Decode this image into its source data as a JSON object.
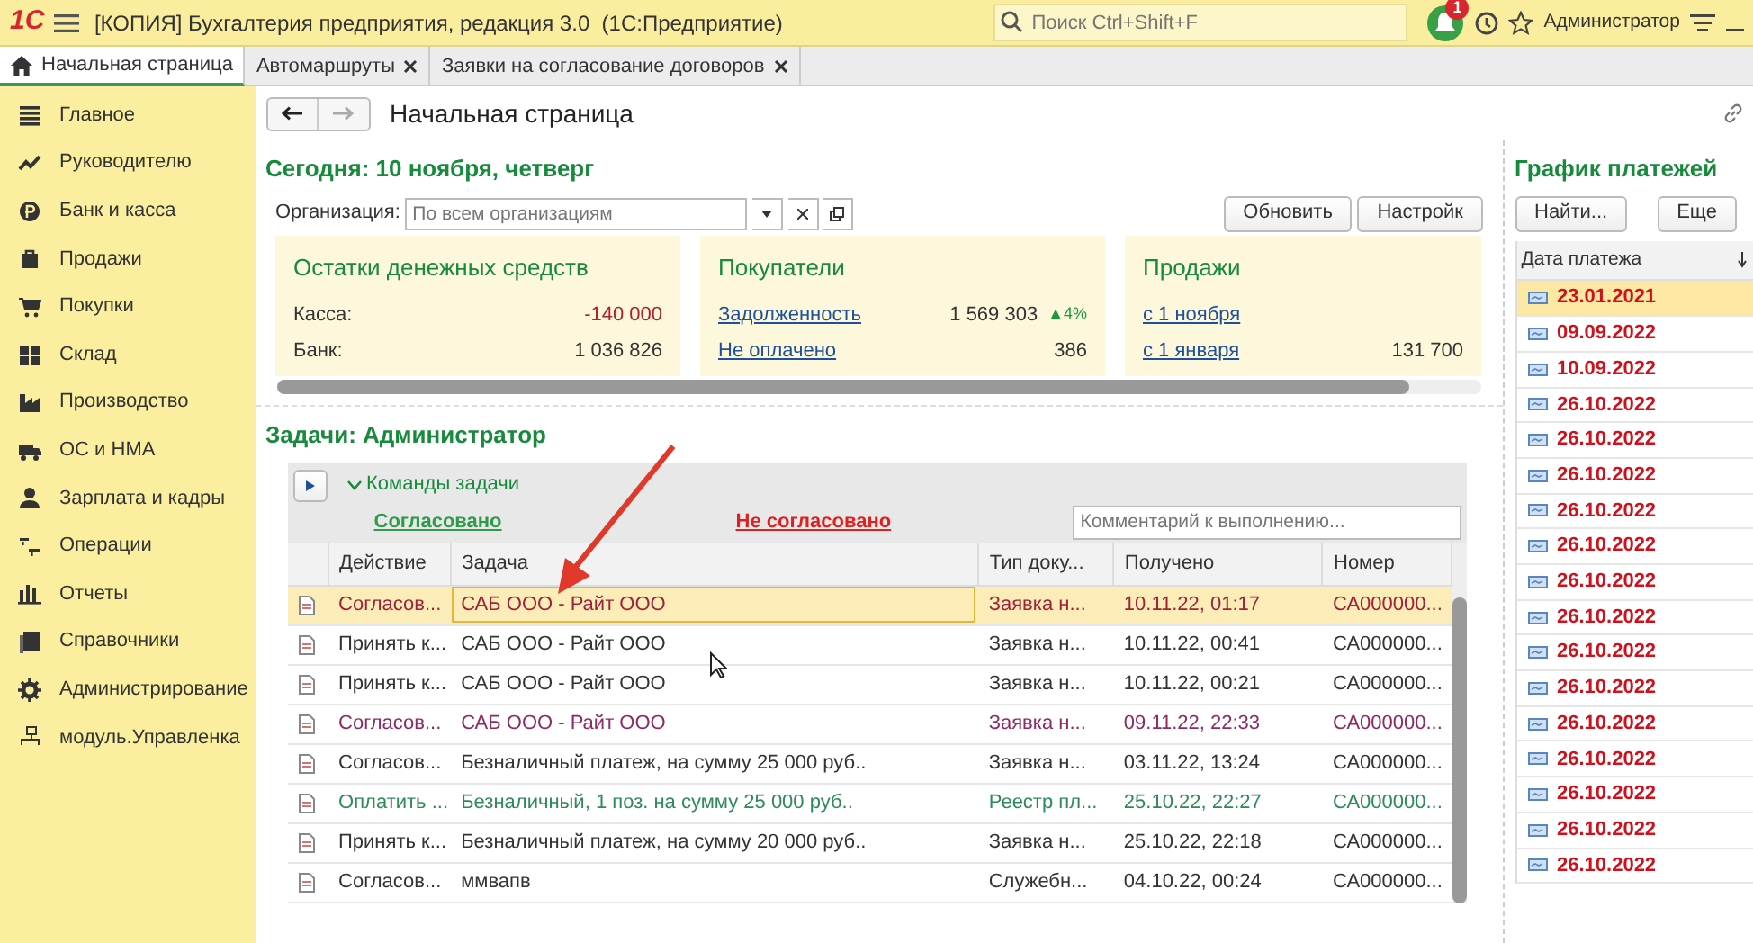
{
  "window": {
    "logo": "1С",
    "title": "[КОПИЯ] Бухгалтерия предприятия, редакция 3.0  (1С:Предприятие)",
    "search_placeholder": "Поиск Ctrl+Shift+F",
    "notifications": "1",
    "user": "Администратор"
  },
  "tabs": [
    {
      "label": "Начальная страница",
      "selected": true,
      "closable": false
    },
    {
      "label": "Автомаршруты",
      "selected": false,
      "closable": true
    },
    {
      "label": "Заявки на согласование договоров",
      "selected": false,
      "closable": true
    }
  ],
  "sidebar": {
    "items": [
      {
        "label": "Главное"
      },
      {
        "label": "Руководителю"
      },
      {
        "label": "Банк и касса"
      },
      {
        "label": "Продажи"
      },
      {
        "label": "Покупки"
      },
      {
        "label": "Склад"
      },
      {
        "label": "Производство"
      },
      {
        "label": "ОС и НМА"
      },
      {
        "label": "Зарплата и кадры"
      },
      {
        "label": "Операции"
      },
      {
        "label": "Отчеты"
      },
      {
        "label": "Справочники"
      },
      {
        "label": "Администрирование"
      },
      {
        "label": "модуль.Управленка"
      }
    ]
  },
  "page": {
    "title": "Начальная страница",
    "today": "Сегодня: 10 ноября, четверг",
    "org_label": "Организация:",
    "org_placeholder": "По всем организациям",
    "buttons": [
      "Обновить",
      "Настройк"
    ],
    "widgets": [
      {
        "title": "Остатки денежных средств",
        "rows": [
          {
            "label": "Касса:",
            "link": false,
            "value": "-140 000",
            "negative": true
          },
          {
            "label": "Банк:",
            "link": false,
            "value": "1 036 826",
            "negative": false
          }
        ]
      },
      {
        "title": "Покупатели",
        "rows": [
          {
            "label": "Задолженность",
            "link": true,
            "value": "1 569 303",
            "negative": false,
            "change": "▲4%"
          },
          {
            "label": "Не оплачено",
            "link": true,
            "value": "386",
            "negative": false
          }
        ]
      },
      {
        "title": "Продажи",
        "rows": [
          {
            "label": "с 1 ноября",
            "link": true
          },
          {
            "label": "с 1 января",
            "link": true,
            "value": "131 700",
            "negative": false
          }
        ]
      }
    ]
  },
  "tasks": {
    "title": "Задачи: Администратор",
    "commands_label": "Команды задачи",
    "expanded": true,
    "approve": "Согласовано",
    "reject": "Не согласовано",
    "comment_placeholder": "Комментарий к выполнению...",
    "columns": [
      "Действие",
      "Задача",
      "Тип доку...",
      "Получено",
      "Номер"
    ],
    "rows": [
      {
        "selected": true,
        "color": "#a0213a",
        "cells": [
          "Согласов...",
          "САБ ООО - Райт ООО",
          "Заявка н...",
          "10.11.22, 01:17",
          "СА000000..."
        ]
      },
      {
        "selected": false,
        "color": "#333333",
        "cells": [
          "Принять к...",
          "САБ ООО - Райт ООО",
          "Заявка н...",
          "10.11.22, 00:41",
          "СА000000..."
        ]
      },
      {
        "selected": false,
        "color": "#333333",
        "cells": [
          "Принять к...",
          "САБ ООО - Райт ООО",
          "Заявка н...",
          "10.11.22, 00:21",
          "СА000000..."
        ]
      },
      {
        "selected": false,
        "color": "#8e2a63",
        "cells": [
          "Согласов...",
          "САБ ООО - Райт ООО",
          "Заявка н...",
          "09.11.22, 22:33",
          "СА000000..."
        ]
      },
      {
        "selected": false,
        "color": "#333333",
        "cells": [
          "Согласов...",
          "Безналичный платеж,  на сумму 25 000 руб..",
          "Заявка н...",
          "03.11.22, 13:24",
          "СА000000..."
        ]
      },
      {
        "selected": false,
        "color": "#2e8b57",
        "cells": [
          "Оплатить ...",
          "Безналичный, 1 поз. на сумму 25 000 руб..",
          "Реестр пл...",
          "25.10.22, 22:27",
          "СА000000..."
        ]
      },
      {
        "selected": false,
        "color": "#333333",
        "cells": [
          "Принять к...",
          "Безналичный платеж,  на сумму 20 000 руб..",
          "Заявка н...",
          "25.10.22, 22:18",
          "СА000000..."
        ]
      },
      {
        "selected": false,
        "color": "#333333",
        "cells": [
          "Согласов...",
          "ммвапв",
          "Служебн...",
          "04.10.22, 00:24",
          "СА000000..."
        ]
      }
    ]
  },
  "payments": {
    "title": "График платежей",
    "buttons": [
      "Найти...",
      "Еще"
    ],
    "column": "Дата платежа",
    "rows": [
      {
        "date": "23.01.2021",
        "selected": true
      },
      {
        "date": "09.09.2022",
        "selected": false
      },
      {
        "date": "10.09.2022",
        "selected": false
      },
      {
        "date": "26.10.2022",
        "selected": false
      },
      {
        "date": "26.10.2022",
        "selected": false
      },
      {
        "date": "26.10.2022",
        "selected": false
      },
      {
        "date": "26.10.2022",
        "selected": false
      },
      {
        "date": "26.10.2022",
        "selected": false
      },
      {
        "date": "26.10.2022",
        "selected": false
      },
      {
        "date": "26.10.2022",
        "selected": false
      },
      {
        "date": "26.10.2022",
        "selected": false
      },
      {
        "date": "26.10.2022",
        "selected": false
      },
      {
        "date": "26.10.2022",
        "selected": false
      },
      {
        "date": "26.10.2022",
        "selected": false
      },
      {
        "date": "26.10.2022",
        "selected": false
      },
      {
        "date": "26.10.2022",
        "selected": false
      },
      {
        "date": "26.10.2022",
        "selected": false
      }
    ]
  }
}
